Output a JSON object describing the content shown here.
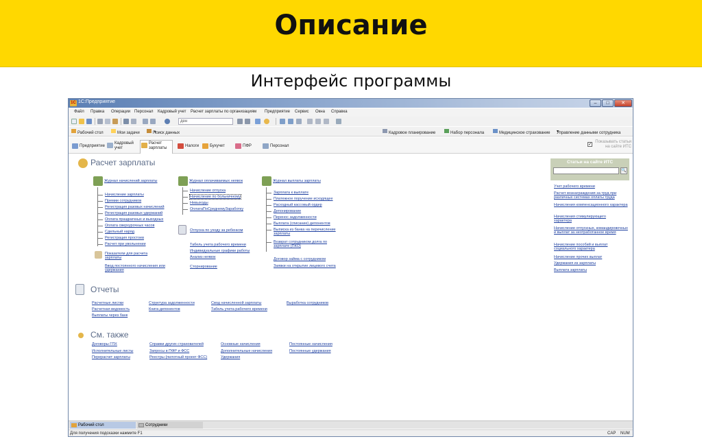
{
  "slide": {
    "title": "Описание",
    "subtitle": "Интерфейс программы"
  },
  "window": {
    "title": "1С:Предприятие",
    "menu": [
      "Файл",
      "Правка",
      "Операции",
      "Персонал",
      "Кадровый учет",
      "Расчет зарплаты по организациям",
      "Предприятие",
      "Сервис",
      "Окна",
      "Справка"
    ],
    "toolbar_search_value": "ден"
  },
  "favorites": {
    "left": [
      "Рабочий стол",
      "Мои задачи",
      "Поиск данных"
    ],
    "right": [
      "Кадровое планирование",
      "Набор персонала",
      "Медицинское страхование",
      "Управление данными сотрудника"
    ]
  },
  "sections": {
    "tabs": [
      "Предприятие",
      "Кадровый учет",
      "Расчет зарплаты",
      "Налоги",
      "Бухучет",
      "ПФР",
      "Персонал"
    ],
    "active": "Расчет зарплаты",
    "its_checkbox_label": "Показывать статьи на сайте ИТС"
  },
  "main": {
    "title": "Расчет зарплаты",
    "col1": {
      "journal": "Журнал начислений зарплаты",
      "items": [
        "Начисление зарплаты",
        "Премии сотрудников",
        "Регистрация разовых начислений",
        "Регистрация разовых удержаний",
        "Оплата праздничных и выходных",
        "Оплата сверхурочных часов",
        "Сдельный наряд",
        "Регистрация простоев",
        "Расчет при увольнении"
      ],
      "extra1": "Показатели для расчета зарплаты",
      "extra2": "Ввод постоянного начисления или удержания"
    },
    "col2": {
      "journal": "Журнал оплачиваемых неявок",
      "items": [
        "Начисление отпуска",
        "Начисление по больничному",
        "Невыходы",
        "ОплатаПоСреднемуЗаработку"
      ],
      "extra_journal": "Отпуска по уходу за ребенком",
      "extra_items": [
        "Табель учета рабочего времени",
        "Индивидуальные графики работы",
        "Анализ неявок",
        "Сторнирование"
      ]
    },
    "col3": {
      "journal": "Журнал выплаты зарплаты",
      "items": [
        "Зарплата к выплате",
        "Платежное поручение исходящее",
        "Расходный кассовый ордер",
        "Депонирование",
        "Перенос задолженности",
        "Выплата (списание) депонентов",
        "Выписка из банка на перечисление зарплаты",
        "Возврат сотрудником долга по зарплате (ПКО)"
      ],
      "extra_items": [
        "Договор займа с сотрудником",
        "Заявки на открытие лицевого счета"
      ]
    }
  },
  "reports": {
    "title": "Отчеты",
    "c1": [
      "Расчетные листки",
      "Расчетная ведомость",
      "Выплаты через банк"
    ],
    "c2": [
      "Структура задолженности",
      "Книга депонентов"
    ],
    "c3": [
      "Свод начисленной зарплаты",
      "Табель учета рабочего времени"
    ],
    "c4": [
      "Выработка сотрудников"
    ]
  },
  "see_also": {
    "title": "См. также",
    "c1": [
      "Договоры ГПХ",
      "Исполнительные листы",
      "Перерасчет зарплаты"
    ],
    "c2": [
      "Справки других страхователей",
      "Запросы в ПФР и ФСС",
      "Реестры (пилотный проект ФСС)"
    ],
    "c3": [
      "Основные начисления",
      "Дополнительные начисления",
      "Удержания"
    ],
    "c4": [
      "Постоянные начисления",
      "Постоянные удержания"
    ]
  },
  "its": {
    "title": "Статьи на сайте ИТС",
    "links": [
      "Учет рабочего времени",
      "Расчет вознаграждения за труд при различных системах оплаты труда",
      "Начисления компенсационного характера",
      "Начисления стимулирующего характера",
      "Начисление отпускных, командировочных и выплат за неотработанное время",
      "Начисление пособий и выплат социального характера",
      "Начисление прочих выплат",
      "Удержания из зарплаты",
      "Выплата зарплаты"
    ]
  },
  "bottom": {
    "tabs": [
      "Рабочий стол",
      "Сотрудники"
    ],
    "status_hint": "Для получения подсказки нажмите F1",
    "indicators": [
      "CAP",
      "NUM"
    ]
  }
}
